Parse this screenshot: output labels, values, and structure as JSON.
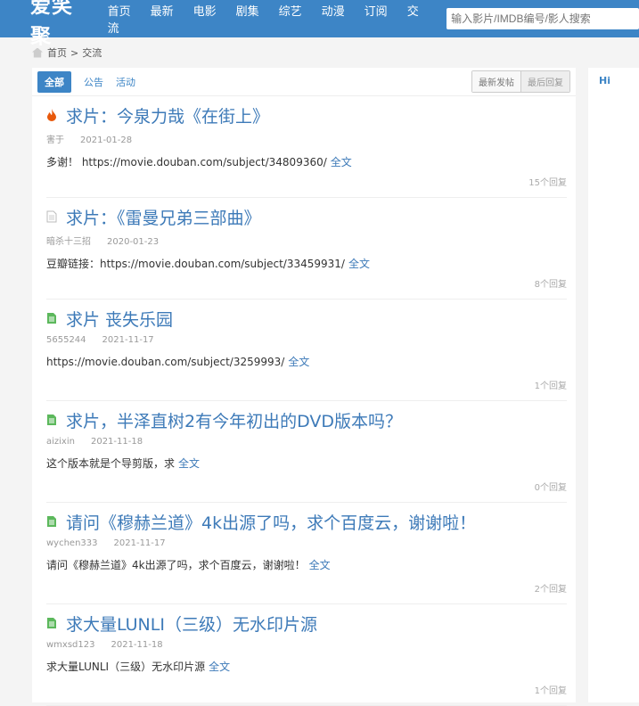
{
  "header": {
    "logo": "爱笑聚",
    "nav": [
      "首页",
      "最新",
      "电影",
      "剧集",
      "综艺",
      "动漫",
      "订阅",
      "交流"
    ],
    "search_placeholder": "输入影片/IMDB编号/影人搜索"
  },
  "breadcrumb": {
    "home": "首页",
    "sep": ">",
    "current": "交流"
  },
  "tabs": [
    "全部",
    "公告",
    "活动"
  ],
  "sort": [
    "最新发帖",
    "最后回复"
  ],
  "sidebar": {
    "title": "Hi"
  },
  "posts": [
    {
      "icon": "fire",
      "title": "求片：今泉力哉《在街上》",
      "author": "害于",
      "date": "2021-01-28",
      "body": "多谢！ https://movie.douban.com/subject/34809360/",
      "more": "全文",
      "replies": "15个回复"
    },
    {
      "icon": "doc-gray",
      "title": "求片：《雷曼兄弟三部曲》",
      "author": "暗杀十三招",
      "date": "2020-01-23",
      "body": "豆瓣链接：https://movie.douban.com/subject/33459931/",
      "more": "全文",
      "replies": "8个回复"
    },
    {
      "icon": "doc-green",
      "title": "求片 丧失乐园",
      "author": "5655244",
      "date": "2021-11-17",
      "body": "https://movie.douban.com/subject/3259993/",
      "more": "全文",
      "replies": "1个回复"
    },
    {
      "icon": "doc-green",
      "title": "求片，半泽直树2有今年初出的DVD版本吗？",
      "author": "aizixin",
      "date": "2021-11-18",
      "body": "这个版本就是个导剪版，求",
      "more": "全文",
      "replies": "0个回复"
    },
    {
      "icon": "doc-green",
      "title": "请问《穆赫兰道》4k出源了吗，求个百度云，谢谢啦！",
      "author": "wychen333",
      "date": "2021-11-17",
      "body": "请问《穆赫兰道》4k出源了吗，求个百度云，谢谢啦！",
      "more": "全文",
      "replies": "2个回复"
    },
    {
      "icon": "doc-green",
      "title": "求大量LUNLI（三级）无水印片源",
      "author": "wmxsd123",
      "date": "2021-11-18",
      "body": "求大量LUNLI（三级）无水印片源",
      "more": "全文",
      "replies": "1个回复"
    }
  ]
}
